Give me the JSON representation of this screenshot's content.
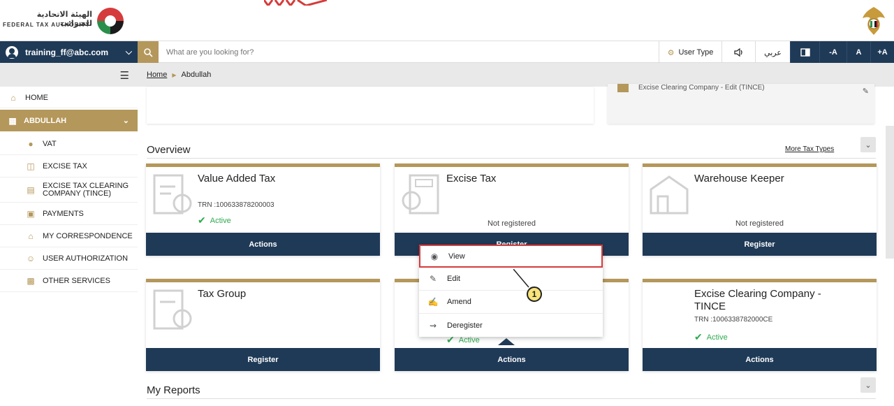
{
  "header": {
    "logo_arabic": "الهيئة الاتحادية للضرائب",
    "logo_english": "FEDERAL TAX AUTHORITY"
  },
  "topbar": {
    "user_email": "training_ff@abc.com",
    "search_placeholder": "What are you looking for?",
    "user_type": "User Type",
    "speaker_icon": "speaker-icon",
    "arabic_label": "عربي",
    "contrast_icon": "contrast-icon",
    "font_decrease": "-A",
    "font_normal": "A",
    "font_increase": "+A"
  },
  "sidebar": {
    "items": [
      {
        "label": "HOME",
        "icon": "home-icon"
      },
      {
        "label": "ABDULLAH",
        "icon": "grid-icon",
        "selected": true
      },
      {
        "label": "VAT",
        "icon": "coins-icon"
      },
      {
        "label": "EXCISE TAX",
        "icon": "excise-icon"
      },
      {
        "label": "EXCISE TAX CLEARING COMPANY (TINCE)",
        "icon": "document-icon"
      },
      {
        "label": "PAYMENTS",
        "icon": "payment-icon"
      },
      {
        "label": "MY CORRESPONDENCE",
        "icon": "building-icon"
      },
      {
        "label": "USER AUTHORIZATION",
        "icon": "user-auth-icon"
      },
      {
        "label": "OTHER SERVICES",
        "icon": "services-icon"
      }
    ]
  },
  "breadcrumb": {
    "home": "Home",
    "current": "Abdullah"
  },
  "top_card_right": {
    "text": "Excise Clearing Company - Edit (TINCE)"
  },
  "overview": {
    "title": "Overview",
    "more_link": "More Tax Types",
    "cards": [
      {
        "title": "Value Added Tax",
        "trn": "TRN :100633878200003",
        "status": "Active",
        "button": "Actions"
      },
      {
        "title": "Excise Tax",
        "note": "Not registered",
        "button": "Register"
      },
      {
        "title": "Warehouse Keeper",
        "note": "Not registered",
        "button": "Register"
      },
      {
        "title": "Tax Group",
        "button": "Register"
      },
      {
        "status": "Active",
        "button": "Actions"
      },
      {
        "title_line1": "Excise Clearing Company -",
        "title_line2": "TINCE",
        "trn": "TRN :1006338782000CE",
        "status": "Active",
        "button": "Actions"
      }
    ]
  },
  "menu": {
    "items": [
      {
        "label": "View",
        "icon": "eye-icon"
      },
      {
        "label": "Edit",
        "icon": "pencil-icon"
      },
      {
        "label": "Amend",
        "icon": "amend-icon"
      },
      {
        "label": "Deregister",
        "icon": "deregister-icon"
      }
    ]
  },
  "callout": {
    "number": "1"
  },
  "reports": {
    "title": "My Reports"
  },
  "colors": {
    "navy": "#1f3a57",
    "gold": "#b4975a",
    "highlight": "#d63b3b",
    "active_green": "#2eaa4f"
  }
}
